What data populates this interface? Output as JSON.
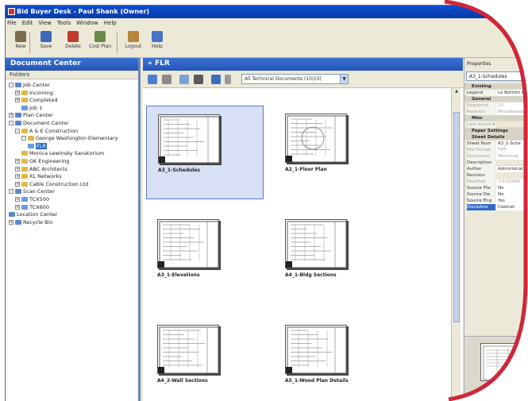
{
  "window": {
    "title": "Bid Buyer Desk - Paul Shank (Owner)"
  },
  "menu": [
    "File",
    "Edit",
    "View",
    "Tools",
    "Window",
    "Help"
  ],
  "toolbar": [
    {
      "label": "New",
      "icon": "new-icon",
      "color": "#7a6e4e"
    },
    {
      "label": "Save",
      "icon": "save-icon",
      "color": "#3f68b8"
    },
    {
      "label": "Delete",
      "icon": "delete-icon",
      "color": "#c23a2a"
    },
    {
      "label": "Cost Plan",
      "icon": "cost-plan-icon",
      "color": "#6a8a4a"
    },
    {
      "label": "Logout",
      "icon": "logout-icon",
      "color": "#b8863a"
    },
    {
      "label": "Help",
      "icon": "help-icon",
      "color": "#4a74c4"
    }
  ],
  "document_center": {
    "title": "Document Center",
    "folders_label": "Folders",
    "tree": [
      {
        "label": "Job Center",
        "depth": 0,
        "expander": "-",
        "icon_color": "#5a86c8"
      },
      {
        "label": "Incoming",
        "depth": 1,
        "expander": "+",
        "icon_color": "#e0b94a"
      },
      {
        "label": "Completed",
        "depth": 1,
        "expander": "+",
        "icon_color": "#e0b94a"
      },
      {
        "label": "Job 1",
        "depth": 2,
        "expander": "",
        "icon_color": "#6a9ae0"
      },
      {
        "label": "Plan Center",
        "depth": 0,
        "expander": "+",
        "icon_color": "#5a86c8"
      },
      {
        "label": "Document Center",
        "depth": 0,
        "expander": "-",
        "icon_color": "#5a86c8"
      },
      {
        "label": "A & E Construction",
        "depth": 1,
        "expander": "-",
        "icon_color": "#e0b94a"
      },
      {
        "label": "George Washington Elementary",
        "depth": 2,
        "expander": "-",
        "icon_color": "#e0b94a"
      },
      {
        "label": "FLR",
        "depth": 3,
        "expander": "",
        "icon_color": "#6a9ae0",
        "selected": true
      },
      {
        "label": "Monica Lewinsky Sanatorium",
        "depth": 2,
        "expander": "",
        "icon_color": "#e0b94a"
      },
      {
        "label": "GK Engineering",
        "depth": 1,
        "expander": "+",
        "icon_color": "#e0b94a"
      },
      {
        "label": "ABC Architects",
        "depth": 1,
        "expander": "+",
        "icon_color": "#e0b94a"
      },
      {
        "label": "XL Networks",
        "depth": 1,
        "expander": "+",
        "icon_color": "#e0b94a"
      },
      {
        "label": "Cable Construction Ltd",
        "depth": 1,
        "expander": "+",
        "icon_color": "#e0b94a"
      },
      {
        "label": "Scan Center",
        "depth": 0,
        "expander": "-",
        "icon_color": "#5a86c8"
      },
      {
        "label": "TCX500",
        "depth": 1,
        "expander": "+",
        "icon_color": "#6a9ae0"
      },
      {
        "label": "TCX600",
        "depth": 1,
        "expander": "+",
        "icon_color": "#6a9ae0"
      },
      {
        "label": "Location Center",
        "depth": 0,
        "expander": "",
        "icon_color": "#5a86c8"
      },
      {
        "label": "Recycle Bin",
        "depth": 0,
        "expander": "+",
        "icon_color": "#5a86c8"
      }
    ]
  },
  "center": {
    "title": "FLR",
    "filter": "All Technical Documents (10/10)",
    "thumbnails": [
      {
        "label": "A3_1-Schedules",
        "selected": true
      },
      {
        "label": "A2_1-Floor Plan",
        "selected": false
      },
      {
        "label": "A3_1-Elevations",
        "selected": false
      },
      {
        "label": "A4_1-Bldg Sections",
        "selected": false
      },
      {
        "label": "A4_2-Wall Sections",
        "selected": false
      },
      {
        "label": "A5_1-Wood Plan Details",
        "selected": false
      }
    ]
  },
  "properties": {
    "header": "Properties",
    "selected_doc": "A3_1-Schedules",
    "rows": [
      {
        "type": "cat",
        "label": "Existing"
      },
      {
        "type": "kv",
        "key": "Legend",
        "value": "Le Bottom Right",
        "dim": false
      },
      {
        "type": "cat",
        "label": "General"
      },
      {
        "type": "kv",
        "key": "Sequence",
        "value": "10",
        "dim": true
      },
      {
        "type": "kv",
        "key": "Revision",
        "value": "Miscellaneous",
        "dim": true
      },
      {
        "type": "cat",
        "label": "Misc"
      },
      {
        "type": "kv",
        "key": "Last Saved By",
        "value": "",
        "dim": true
      },
      {
        "type": "cat",
        "label": "Paper Settings"
      },
      {
        "type": "cat",
        "label": "Sheet Details"
      },
      {
        "type": "kv",
        "key": "Sheet Num",
        "value": "A3_1-Sche",
        "dim": false
      },
      {
        "type": "kv",
        "key": "File Format",
        "value": "TIFF",
        "dim": true
      },
      {
        "type": "kv",
        "key": "Document",
        "value": "Technical",
        "dim": true
      },
      {
        "type": "kv",
        "key": "Description",
        "value": "",
        "dim": false
      },
      {
        "type": "kv",
        "key": "Author",
        "value": "Administrat",
        "dim": false
      },
      {
        "type": "kv",
        "key": "Revision",
        "value": "",
        "dim": false
      },
      {
        "type": "kv",
        "key": "Modified",
        "value": "7/17/2006",
        "dim": true
      },
      {
        "type": "kv",
        "key": "Source File",
        "value": "No",
        "dim": false
      },
      {
        "type": "kv",
        "key": "Source Dw",
        "value": "No",
        "dim": false
      },
      {
        "type": "kv",
        "key": "Source Eng",
        "value": "Yes",
        "dim": false
      },
      {
        "type": "kv",
        "key": "Discipline",
        "value": "Cabinet",
        "dim": false,
        "selected": true
      }
    ]
  },
  "accent": {
    "window_blue": "#0b4ecf",
    "panel_blue": "#2454b5",
    "selection": "#316ac5",
    "frame_red": "#d0263a"
  }
}
